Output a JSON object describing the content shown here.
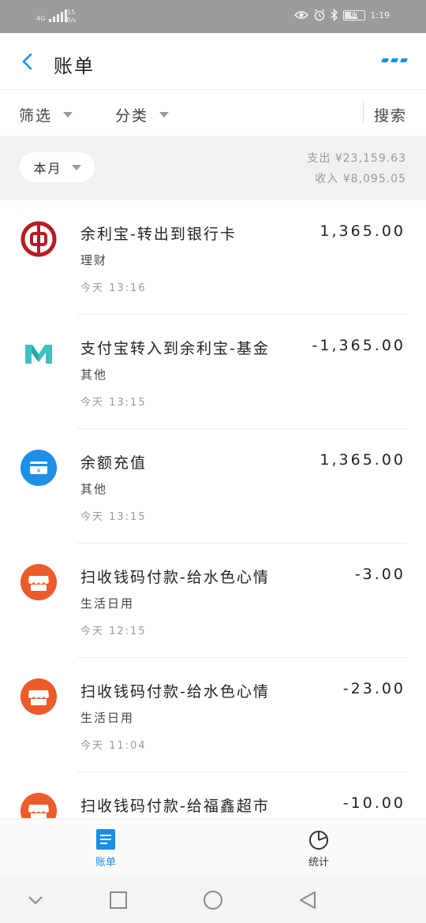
{
  "status": {
    "network": "4G",
    "speed_value": "15",
    "speed_unit": "B/s",
    "battery": "65",
    "time": "1:19"
  },
  "header": {
    "title": "账单",
    "back_icon": "chevron-left-icon",
    "more_icon": "more-dots-icon",
    "accent": "#1a8ee5"
  },
  "filters": {
    "filter_label": "筛选",
    "category_label": "分类",
    "search_label": "搜索"
  },
  "month": {
    "selector_label": "本月",
    "expense_summary": "支出 ¥23,159.63",
    "income_summary": "收入 ¥8,095.05"
  },
  "transactions": [
    {
      "icon": "bank-of-china-icon",
      "name": "余利宝-转出到银行卡",
      "category": "理财",
      "date": "今天  13:16",
      "amount": "1,365.00"
    },
    {
      "icon": "mybank-icon",
      "name": "支付宝转入到余利宝-基金",
      "category": "其他",
      "date": "今天  13:15",
      "amount": "-1,365.00"
    },
    {
      "icon": "recharge-icon",
      "name": "余额充值",
      "category": "其他",
      "date": "今天  13:15",
      "amount": "1,365.00"
    },
    {
      "icon": "shop-icon",
      "name": "扫收钱码付款-给水色心情",
      "category": "生活日用",
      "date": "今天  12:15",
      "amount": "-3.00"
    },
    {
      "icon": "shop-icon",
      "name": "扫收钱码付款-给水色心情",
      "category": "生活日用",
      "date": "今天  11:04",
      "amount": "-23.00"
    },
    {
      "icon": "shop-icon",
      "name": "扫收钱码付款-给福鑫超市",
      "category": "",
      "date": "",
      "amount": "-10.00"
    }
  ],
  "tabbar": {
    "bill_label": "账单",
    "stats_label": "统计"
  },
  "colors": {
    "brand_blue": "#1a8ee5",
    "shop_orange": "#ec5b2a",
    "boc_red": "#b81c22",
    "mybank_teal": "#3cc3c0"
  }
}
